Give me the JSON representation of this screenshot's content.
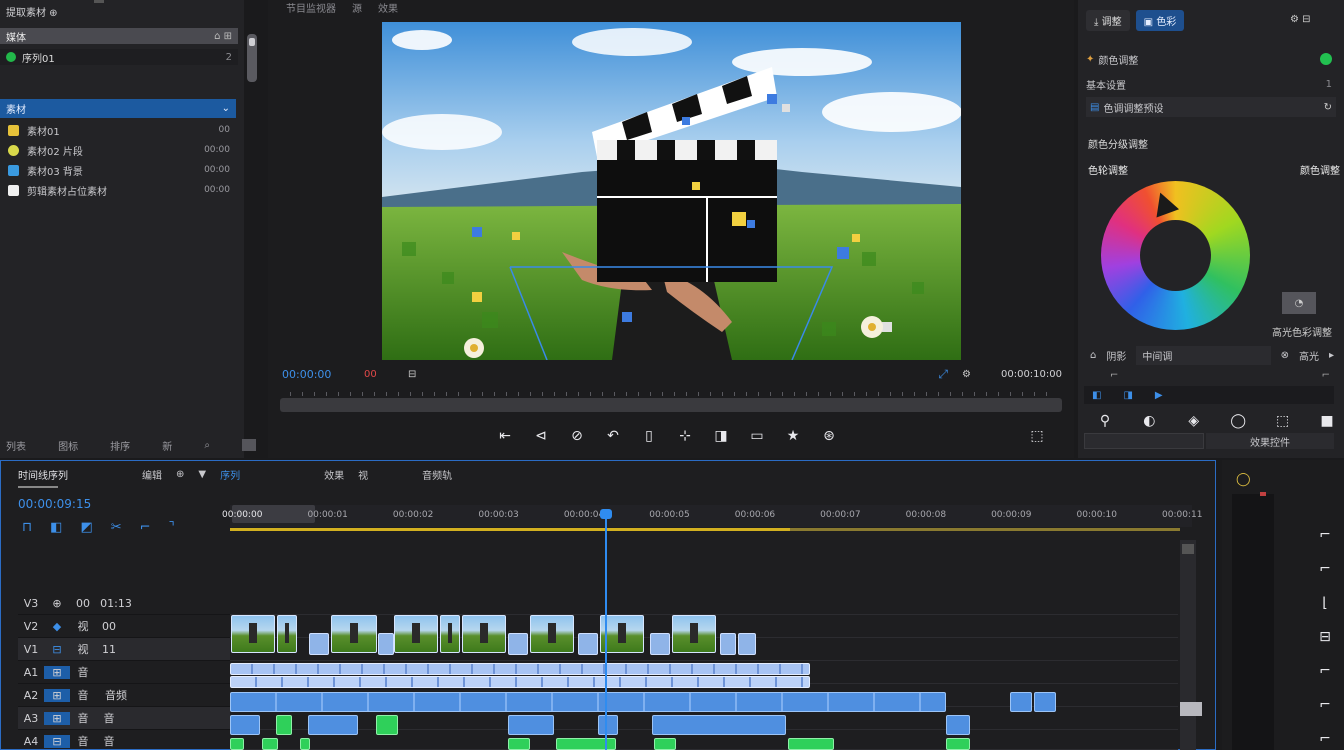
{
  "project_panel": {
    "header": "提取素材 ⊕",
    "bin_row": "媒体",
    "bin_row_right": "⌂ ⊞",
    "sequence_item": "序列01",
    "sequence_count": "2",
    "section": "素材",
    "items": [
      {
        "name": "素材01",
        "time": "00",
        "color": "#e6c23a"
      },
      {
        "name": "素材02 片段",
        "time": "00:00",
        "color": "#d8d84a"
      },
      {
        "name": "素材03 背景",
        "time": "00:00",
        "color": "#3a9ae0"
      },
      {
        "name": "剪辑素材占位素材",
        "time": "00:00",
        "color": "#f0f0f0"
      }
    ],
    "footer": [
      "列表",
      "图标",
      "排序",
      "新",
      "⌕"
    ]
  },
  "program_monitor": {
    "tabs": [
      "节目监视器",
      "源",
      "效果"
    ],
    "timecode_left": "00:00:00",
    "timecode_mid": "00",
    "fit_label": "⊟",
    "timecode_right": "00:00:10:00",
    "transport": [
      "⇤",
      "⊲",
      "⊘",
      "↶",
      "▯",
      "⊹",
      "◨",
      "▭",
      "★",
      "⊛"
    ],
    "export_icon": "⬚"
  },
  "right_panel": {
    "tabs": [
      "调整",
      "色彩"
    ],
    "tab_right": "⚙ ⊟",
    "header_row": "颜色调整",
    "header_badge": "●",
    "sub_label": "基本设置",
    "sub_value": "1",
    "preset_label": "色调调整预设",
    "section_title": "颜色分级调整",
    "wheel_left_label": "色轮调整",
    "wheel_right_label": "颜色调整",
    "wheel_caption": "高光色彩调整",
    "controls_row": [
      "⌂",
      "阴影",
      "中间调",
      "⊗",
      "高光",
      "▸"
    ],
    "small_row": [
      "⌐",
      "⌐"
    ],
    "bottom_tabs": [
      "◧",
      "◨",
      "▶"
    ],
    "tools": [
      "⚲",
      "◐",
      "◈",
      "◯",
      "⬚",
      "■"
    ],
    "footer_btn_left": "",
    "footer_btn_right": "效果控件"
  },
  "timeline": {
    "title": "时间线序列",
    "header_items": [
      "编辑",
      "⊕",
      "▼",
      "序列"
    ],
    "header_items2": [
      "效果",
      "视"
    ],
    "header_items3": [
      "音频轨"
    ],
    "timecode": "00:00:09:15",
    "ruler_labels": [
      "00:00:00",
      "00:00:01",
      "00:00:02",
      "00:00:03",
      "00:00:04",
      "00:00:05",
      "00:00:06",
      "00:00:07",
      "00:00:08",
      "00:00:09",
      "00:00:10",
      "00:00:11"
    ],
    "tracks": [
      {
        "a": "V3",
        "b": "⊕",
        "c": "00",
        "d": "01:13"
      },
      {
        "a": "V2",
        "b": "◆",
        "c": "视",
        "d": "00"
      },
      {
        "a": "V1",
        "b": "⊟",
        "c": "视",
        "d": "11"
      },
      {
        "a": "A1",
        "b": "⊞",
        "c": "音",
        "d": ""
      },
      {
        "a": "A2",
        "b": "⊞",
        "c": "音",
        "d": "音频"
      },
      {
        "a": "A3",
        "b": "⊞",
        "c": "音",
        "d": "音"
      },
      {
        "a": "A4",
        "b": "⊟",
        "c": "音",
        "d": "音"
      }
    ]
  },
  "tools_panel": {
    "top_icon": "◯",
    "tools": [
      "⌐",
      "⌐",
      "⌊",
      "⊟",
      "⌐",
      "⌐",
      "⌐"
    ]
  }
}
